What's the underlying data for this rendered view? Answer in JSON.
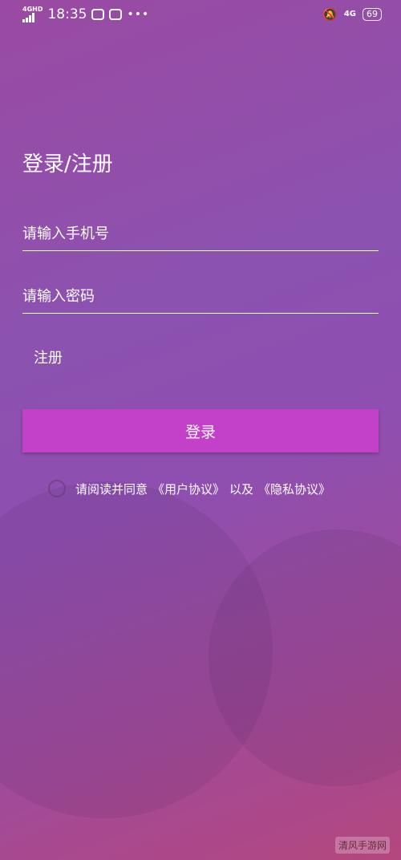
{
  "status_bar": {
    "network": "4GHD",
    "time": "18:35",
    "right_network": "4G",
    "battery": "69"
  },
  "page": {
    "title": "登录/注册",
    "phone_placeholder": "请输入手机号",
    "password_placeholder": "请输入密码",
    "register_label": "注册",
    "login_label": "登录",
    "agree_text": "请阅读并同意",
    "user_agreement": "《用户协议》",
    "and_text": "以及",
    "privacy_policy": "《隐私协议》"
  },
  "watermark": "清风手游网",
  "colors": {
    "accent": "#c241c8"
  }
}
